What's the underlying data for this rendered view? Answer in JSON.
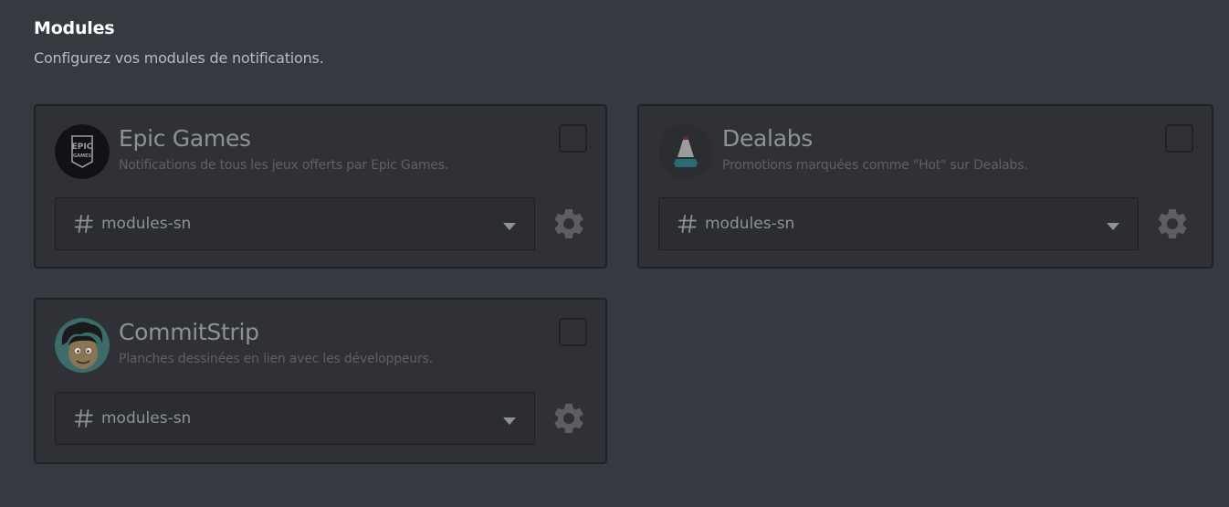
{
  "header": {
    "title": "Modules",
    "subtitle": "Configurez vos modules de notifications."
  },
  "modules": [
    {
      "title": "Epic Games",
      "description": "Notifications de tous les jeux offerts par Epic Games.",
      "icon": "epic-games-logo",
      "logo_text_top": "EPIC",
      "logo_text_bottom": "GAMES",
      "channel": "modules-sn",
      "enabled": false
    },
    {
      "title": "Dealabs",
      "description": "Promotions marquées comme \"Hot\" sur Dealabs.",
      "icon": "dealabs-logo",
      "channel": "modules-sn",
      "enabled": false
    },
    {
      "title": "CommitStrip",
      "description": "Planches dessinées en lien avec les développeurs.",
      "icon": "commitstrip-logo",
      "channel": "modules-sn",
      "enabled": false
    }
  ],
  "colors": {
    "background": "#36393f",
    "card": "#2f3136",
    "card_border": "#202225",
    "select": "#2b2d31",
    "title_text": "#8e9297",
    "desc_text": "#5e6064",
    "gear": "#5c5e63"
  }
}
